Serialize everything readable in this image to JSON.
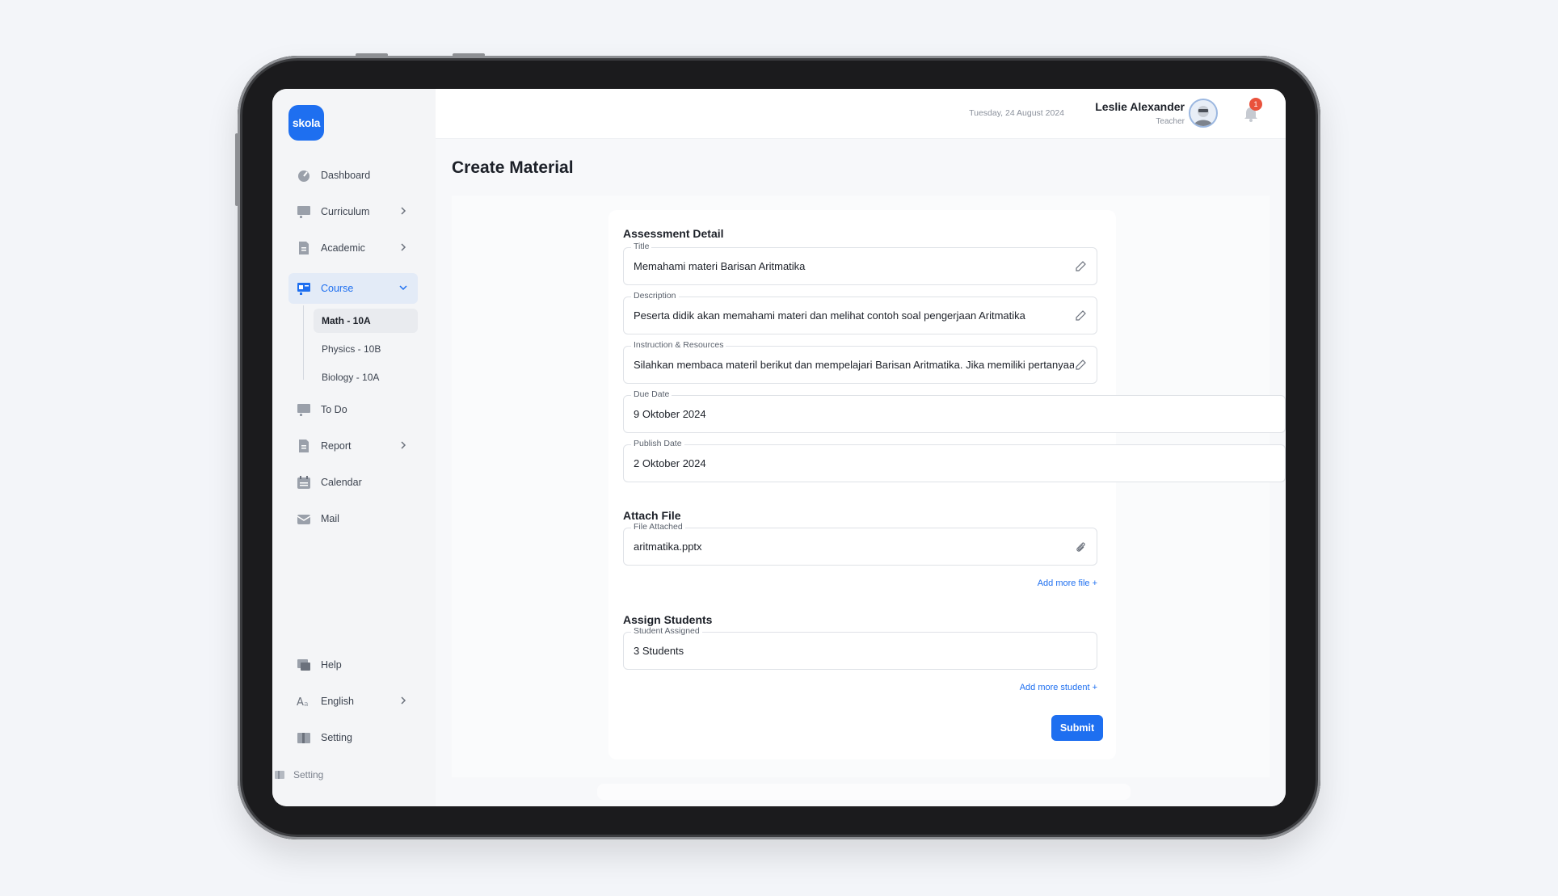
{
  "brand": {
    "logo_text": "skola",
    "accent": "#1e6ff0"
  },
  "header": {
    "date": "Tuesday, 24 August 2024",
    "user_name": "Leslie Alexander",
    "user_role": "Teacher",
    "notification_count": "1"
  },
  "sidebar": {
    "items": [
      {
        "label": "Dashboard",
        "icon": "dashboard-icon"
      },
      {
        "label": "Curriculum",
        "icon": "curriculum-icon"
      },
      {
        "label": "Academic",
        "icon": "academic-icon"
      },
      {
        "label": "Course",
        "icon": "course-icon"
      },
      {
        "label": "To Do",
        "icon": "todo-icon"
      },
      {
        "label": "Report",
        "icon": "report-icon"
      },
      {
        "label": "Calendar",
        "icon": "calendar-icon"
      },
      {
        "label": "Mail",
        "icon": "mail-icon"
      }
    ],
    "course_sub": [
      "Math - 10A",
      "Physics - 10B",
      "Biology - 10A"
    ],
    "bottom": [
      {
        "label": "Help",
        "icon": "help-icon"
      },
      {
        "label": "English",
        "icon": "language-icon"
      },
      {
        "label": "Setting",
        "icon": "setting-icon"
      }
    ],
    "ghost_setting": "Setting"
  },
  "page": {
    "title": "Create Material",
    "assessment_title": "Assessment Detail",
    "fields": {
      "title": {
        "label": "Title",
        "value": "Memahami materi Barisan Aritmatika"
      },
      "description": {
        "label": "Description",
        "value": "Peserta didik akan memahami materi dan melihat contoh soal pengerjaan Aritmatika"
      },
      "instruction": {
        "label": "Instruction & Resources",
        "value": "Silahkan membaca materil berikut dan mempelajari Barisan Aritmatika. Jika memiliki pertanyaan"
      },
      "due_date": {
        "label": "Due Date",
        "value": "9 Oktober 2024"
      },
      "publish_date": {
        "label": "Publish Date",
        "value": "2 Oktober 2024"
      }
    },
    "attach_title": "Attach File",
    "file": {
      "label": "File Attached",
      "value": "aritmatika.pptx"
    },
    "add_file": "Add more file +",
    "assign_title": "Assign Students",
    "students": {
      "label": "Student Assigned",
      "value": "3 Students"
    },
    "add_student": "Add more student +",
    "submit": "Submit"
  }
}
